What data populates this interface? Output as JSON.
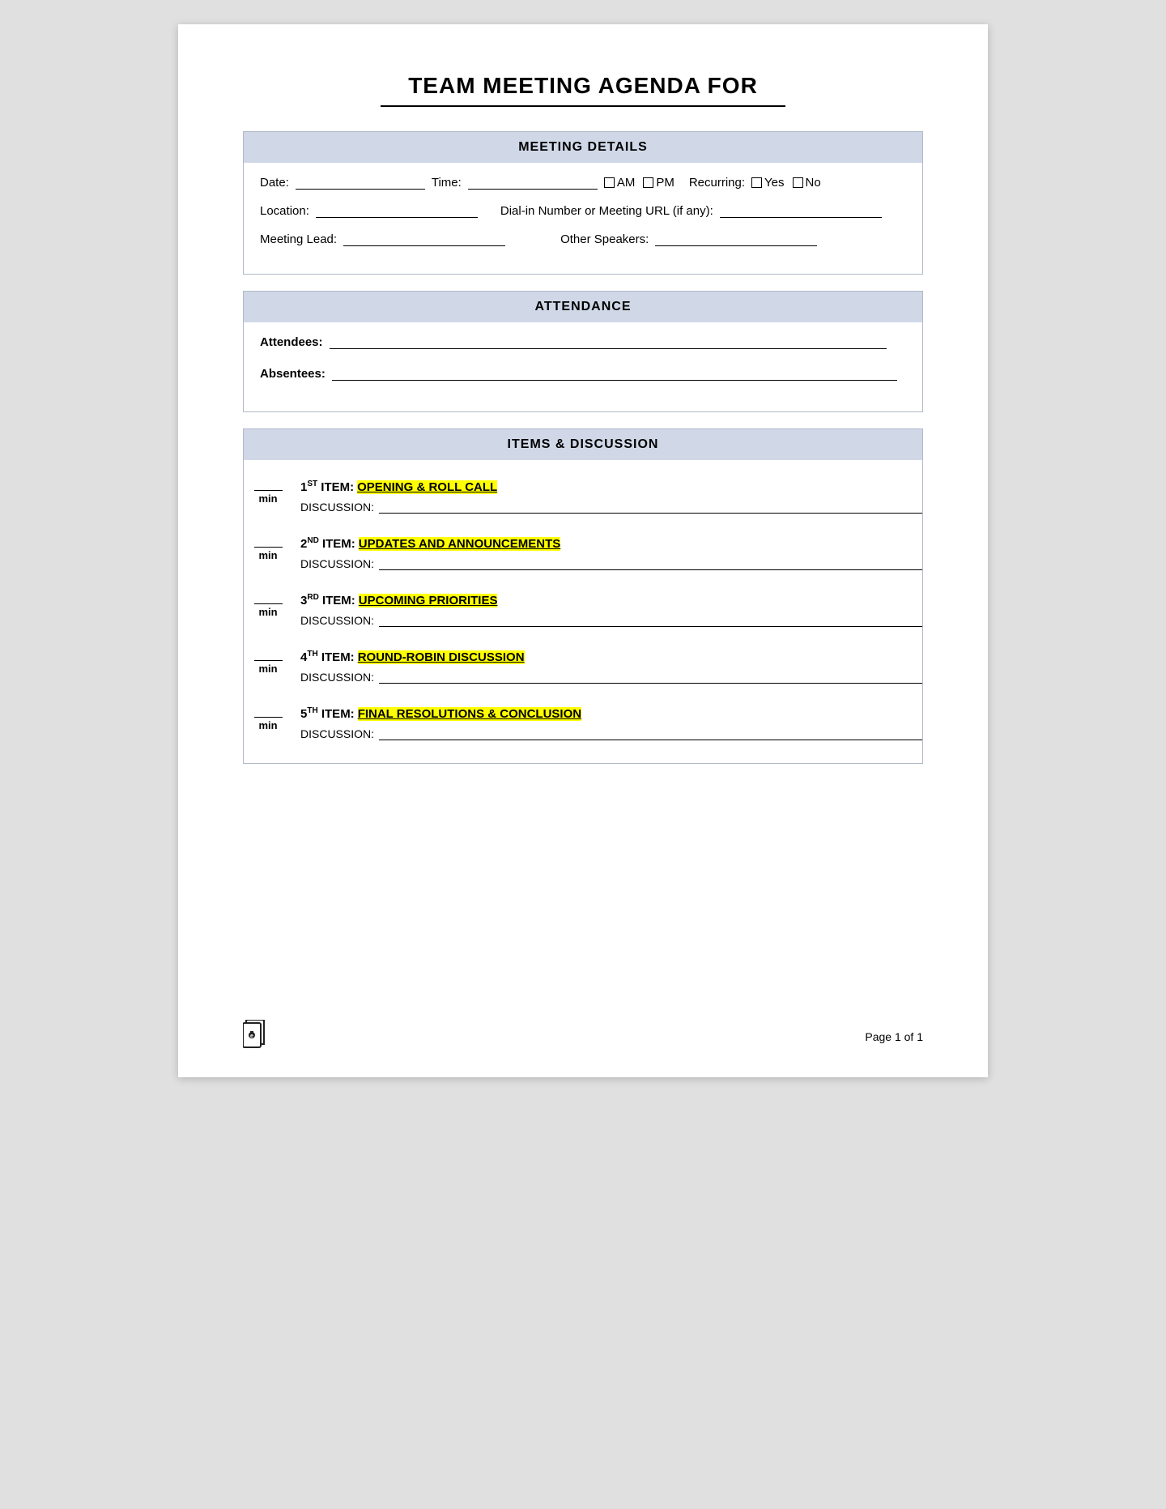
{
  "title": "TEAM MEETING AGENDA FOR",
  "sections": {
    "meeting_details": {
      "header": "MEETING DETAILS",
      "fields": {
        "date_label": "Date:",
        "time_label": "Time:",
        "am_label": "AM",
        "pm_label": "PM",
        "recurring_label": "Recurring:",
        "yes_label": "Yes",
        "no_label": "No",
        "location_label": "Location:",
        "dialin_label": "Dial-in Number or Meeting URL (if any):",
        "meeting_lead_label": "Meeting Lead:",
        "other_speakers_label": "Other Speakers:"
      }
    },
    "attendance": {
      "header": "ATTENDANCE",
      "attendees_label": "Attendees:",
      "absentees_label": "Absentees:"
    },
    "items_discussion": {
      "header": "ITEMS & DISCUSSION",
      "items": [
        {
          "number": "1",
          "ordinal": "ST",
          "name": "OPENING & ROLL CALL",
          "discussion_label": "DISCUSSION:"
        },
        {
          "number": "2",
          "ordinal": "ND",
          "name": "UPDATES AND ANNOUNCEMENTS",
          "discussion_label": "DISCUSSION:"
        },
        {
          "number": "3",
          "ordinal": "RD",
          "name": "UPCOMING PRIORITIES",
          "discussion_label": "DISCUSSION:"
        },
        {
          "number": "4",
          "ordinal": "TH",
          "name": "ROUND-ROBIN DISCUSSION",
          "discussion_label": "DISCUSSION:"
        },
        {
          "number": "5",
          "ordinal": "TH",
          "name": "FINAL RESOLUTIONS & CONCLUSION",
          "discussion_label": "DISCUSSION:"
        }
      ]
    }
  },
  "footer": {
    "page_text": "Page 1 of 1"
  },
  "colors": {
    "section_header_bg": "#d0d8e8",
    "highlight_yellow": "#ffff00"
  }
}
